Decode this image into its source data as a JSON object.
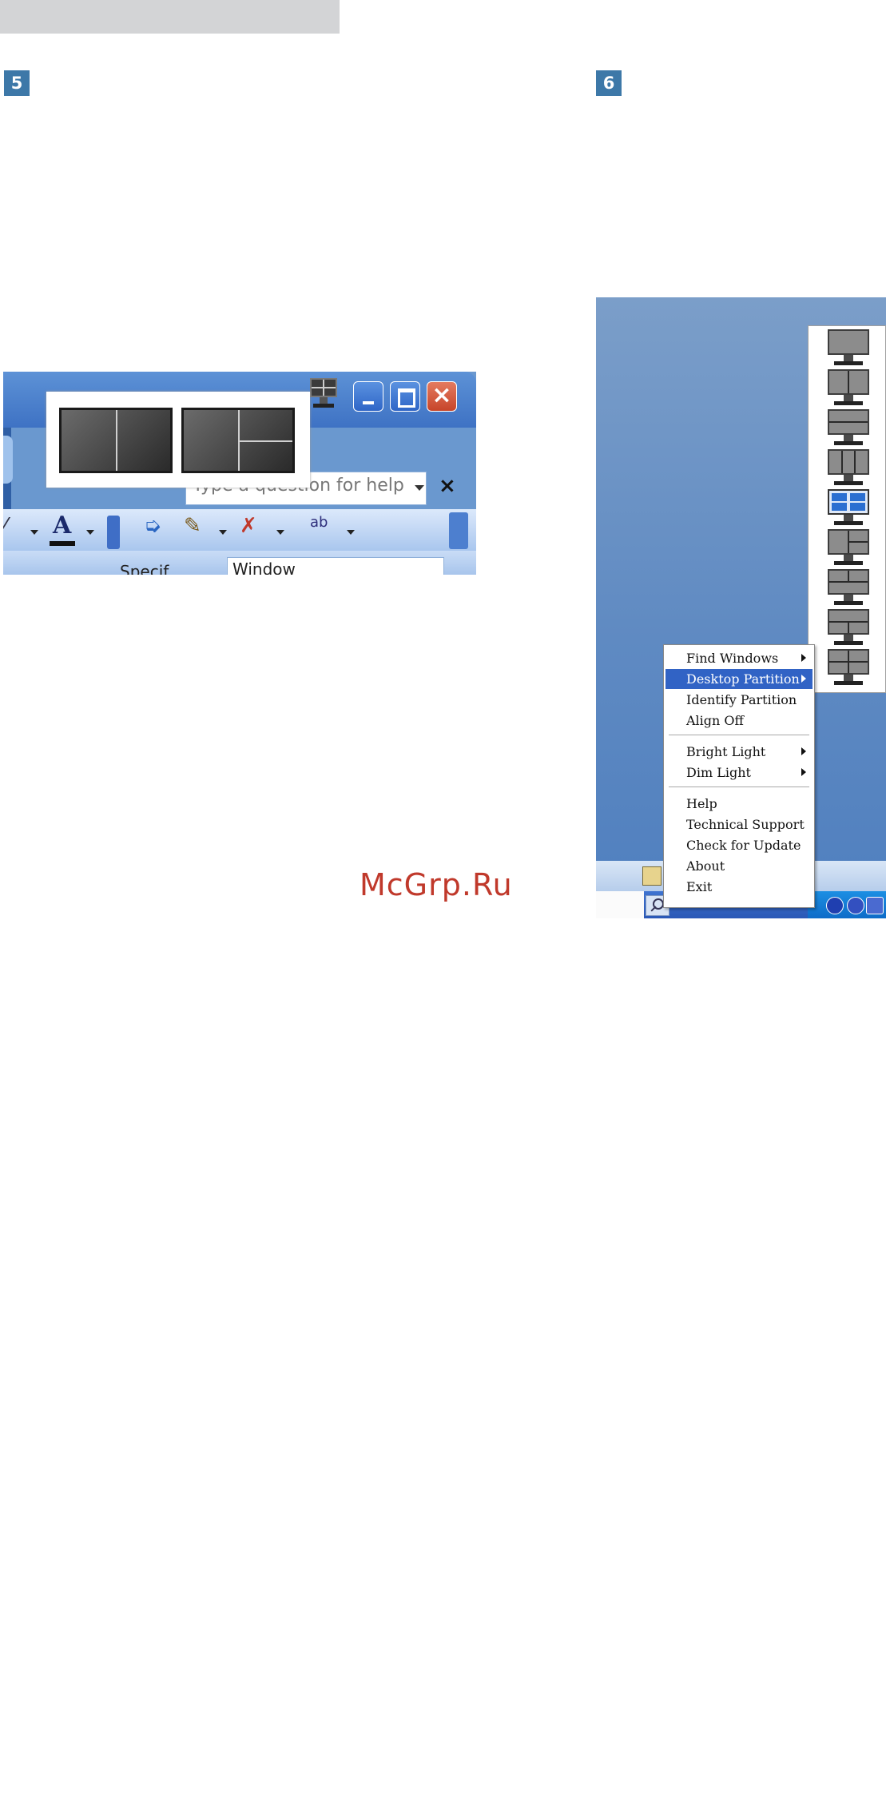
{
  "steps": {
    "left": "5",
    "right": "6"
  },
  "watermark": "McGrp.Ru",
  "office_window": {
    "help_placeholder": "Type a question for help",
    "close_glyph": "×",
    "toolbar_font_letter": "A",
    "toolbar_spell_label": "ab",
    "window_field_value": "Window",
    "specify_label": "Specif..."
  },
  "partition_icons": [
    "full",
    "split-vertical",
    "split-horizontal",
    "three-vertical",
    "quad-grid",
    "left-right-split-top",
    "two-top-one-bottom",
    "one-top-two-bottom",
    "four-quarters"
  ],
  "selected_partition": "quad-grid",
  "context_menu": {
    "groups": [
      [
        {
          "label": "Find Windows",
          "submenu": true
        },
        {
          "label": "Desktop Partition",
          "submenu": true,
          "highlighted": true
        },
        {
          "label": "Identify Partition",
          "submenu": false
        },
        {
          "label": "Align Off",
          "submenu": false
        }
      ],
      [
        {
          "label": "Bright Light",
          "submenu": true
        },
        {
          "label": "Dim Light",
          "submenu": true
        }
      ],
      [
        {
          "label": "Help",
          "submenu": false
        },
        {
          "label": "Technical Support",
          "submenu": false
        },
        {
          "label": "Check for Update",
          "submenu": false
        },
        {
          "label": "About",
          "submenu": false
        },
        {
          "label": "Exit",
          "submenu": false
        }
      ]
    ]
  },
  "colors": {
    "accent": "#3d78a8",
    "menu_highlight": "#3163c5",
    "watermark": "#c0392b"
  }
}
